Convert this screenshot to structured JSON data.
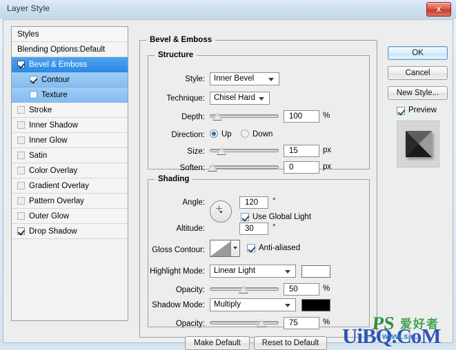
{
  "window": {
    "title": "Layer Style",
    "close_label": "x"
  },
  "sidebar": {
    "header": "Styles",
    "blending_options": "Blending Options:Default",
    "items": [
      {
        "label": "Bevel & Emboss",
        "checked": true,
        "selected": true,
        "indent": false
      },
      {
        "label": "Contour",
        "checked": true,
        "selected": false,
        "indent": true
      },
      {
        "label": "Texture",
        "checked": false,
        "selected": false,
        "indent": true
      },
      {
        "label": "Stroke",
        "checked": false,
        "selected": false,
        "indent": false
      },
      {
        "label": "Inner Shadow",
        "checked": false,
        "selected": false,
        "indent": false
      },
      {
        "label": "Inner Glow",
        "checked": false,
        "selected": false,
        "indent": false
      },
      {
        "label": "Satin",
        "checked": false,
        "selected": false,
        "indent": false
      },
      {
        "label": "Color Overlay",
        "checked": false,
        "selected": false,
        "indent": false
      },
      {
        "label": "Gradient Overlay",
        "checked": false,
        "selected": false,
        "indent": false
      },
      {
        "label": "Pattern Overlay",
        "checked": false,
        "selected": false,
        "indent": false
      },
      {
        "label": "Outer Glow",
        "checked": false,
        "selected": false,
        "indent": false
      },
      {
        "label": "Drop Shadow",
        "checked": true,
        "selected": false,
        "indent": false
      }
    ]
  },
  "main": {
    "group_title": "Bevel & Emboss",
    "structure": {
      "title": "Structure",
      "style_label": "Style:",
      "style_value": "Inner Bevel",
      "technique_label": "Technique:",
      "technique_value": "Chisel Hard",
      "depth_label": "Depth:",
      "depth_value": "100",
      "depth_unit": "%",
      "direction_label": "Direction:",
      "direction_up": "Up",
      "direction_down": "Down",
      "direction_selected": "Up",
      "size_label": "Size:",
      "size_value": "15",
      "size_unit": "px",
      "soften_label": "Soften:",
      "soften_value": "0",
      "soften_unit": "px"
    },
    "shading": {
      "title": "Shading",
      "angle_label": "Angle:",
      "angle_value": "120",
      "angle_unit": "°",
      "use_global_light_label": "Use Global Light",
      "use_global_light_checked": true,
      "altitude_label": "Altitude:",
      "altitude_value": "30",
      "altitude_unit": "°",
      "gloss_contour_label": "Gloss Contour:",
      "anti_aliased_label": "Anti-aliased",
      "anti_aliased_checked": true,
      "highlight_mode_label": "Highlight Mode:",
      "highlight_mode_value": "Linear Light",
      "highlight_color": "#ffffff",
      "highlight_opacity_label": "Opacity:",
      "highlight_opacity_value": "50",
      "highlight_opacity_unit": "%",
      "shadow_mode_label": "Shadow Mode:",
      "shadow_mode_value": "Multiply",
      "shadow_color": "#000000",
      "shadow_opacity_label": "Opacity:",
      "shadow_opacity_value": "75",
      "shadow_opacity_unit": "%"
    }
  },
  "right_panel": {
    "ok": "OK",
    "cancel": "Cancel",
    "new_style": "New Style...",
    "preview_label": "Preview",
    "preview_checked": true
  },
  "footer": {
    "make_default": "Make Default",
    "reset_to_default": "Reset to Default"
  },
  "watermark": {
    "main": "UiBQ.CoM",
    "ps": "PS",
    "cn": "爱好者",
    "url": "www.sa..."
  }
}
